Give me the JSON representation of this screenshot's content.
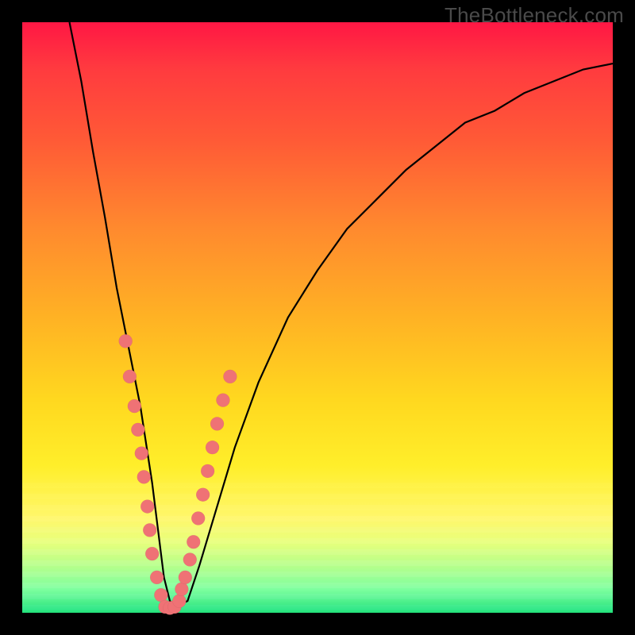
{
  "watermark": "TheBottleneck.com",
  "colors": {
    "frame": "#000000",
    "dot": "#ef7275",
    "curve": "#000000"
  },
  "chart_data": {
    "type": "line",
    "title": "",
    "xlabel": "",
    "ylabel": "",
    "xlim": [
      0,
      100
    ],
    "ylim": [
      0,
      100
    ],
    "curve": {
      "x": [
        8,
        10,
        12,
        14,
        16,
        18,
        20,
        22,
        23,
        24,
        25,
        26,
        28,
        30,
        33,
        36,
        40,
        45,
        50,
        55,
        60,
        65,
        70,
        75,
        80,
        85,
        90,
        95,
        100
      ],
      "y": [
        100,
        90,
        78,
        67,
        55,
        45,
        35,
        22,
        14,
        6,
        2,
        1,
        2,
        8,
        18,
        28,
        39,
        50,
        58,
        65,
        70,
        75,
        79,
        83,
        85,
        88,
        90,
        92,
        93
      ]
    },
    "scatter": {
      "x": [
        17.5,
        18.2,
        19,
        19.6,
        20.2,
        20.6,
        21.2,
        21.6,
        22,
        22.8,
        23.5,
        24.2,
        25,
        25.8,
        26.6,
        27,
        27.6,
        28.4,
        29,
        29.8,
        30.6,
        31.4,
        32.2,
        33,
        34,
        35.2
      ],
      "y": [
        46,
        40,
        35,
        31,
        27,
        23,
        18,
        14,
        10,
        6,
        3,
        1,
        0.8,
        1,
        2,
        4,
        6,
        9,
        12,
        16,
        20,
        24,
        28,
        32,
        36,
        40
      ]
    }
  }
}
